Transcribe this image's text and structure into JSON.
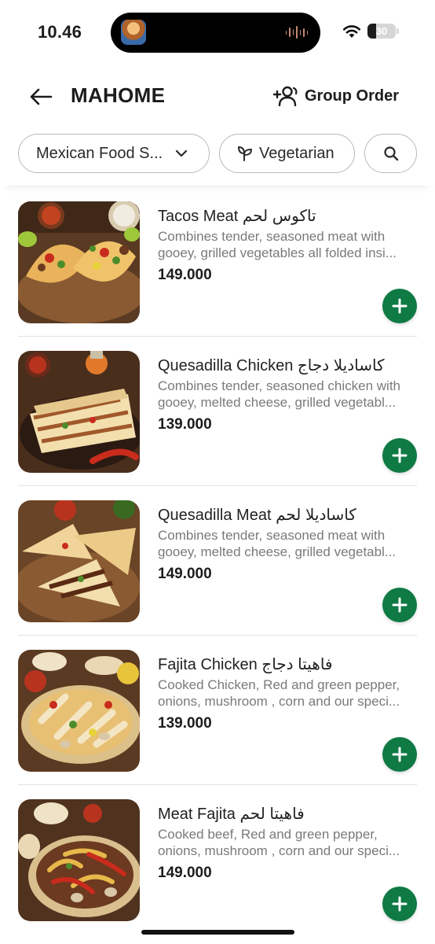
{
  "status_bar": {
    "time": "10.46",
    "battery": "30",
    "battery_level": 0.3
  },
  "header": {
    "title": "MAHOME",
    "group_order_label": "Group Order"
  },
  "filters": {
    "category_label": "Mexican Food S...",
    "vegetarian_label": "Vegetarian"
  },
  "menu_items": [
    {
      "name": "Tacos Meat تاكوس لحم",
      "desc_line1": "Combines tender, seasoned meat with",
      "desc_line2": "gooey, grilled vegetables all folded insi...",
      "price": "149.000"
    },
    {
      "name": "Quesadilla Chicken كاساديلا دجاج",
      "desc_line1": "Combines tender, seasoned chicken with",
      "desc_line2": "gooey, melted cheese, grilled vegetabl...",
      "price": "139.000"
    },
    {
      "name": "Quesadilla Meat كاساديلا لحم",
      "desc_line1": "Combines tender, seasoned meat with",
      "desc_line2": "gooey, melted cheese, grilled vegetabl...",
      "price": "149.000"
    },
    {
      "name": "Fajita Chicken  فاهيتا دجاج",
      "desc_line1": "Cooked Chicken, Red and green pepper,",
      "desc_line2": "onions, mushroom , corn and our speci...",
      "price": "139.000"
    },
    {
      "name": "Meat Fajita فاهيتا لحم",
      "desc_line1": "Cooked beef, Red and green pepper,",
      "desc_line2": "onions, mushroom , corn and our speci...",
      "price": "149.000"
    }
  ],
  "colors": {
    "accent": "#0f7a44",
    "chip_border": "#b9b9b9",
    "desc_text": "#7a7a7a"
  }
}
